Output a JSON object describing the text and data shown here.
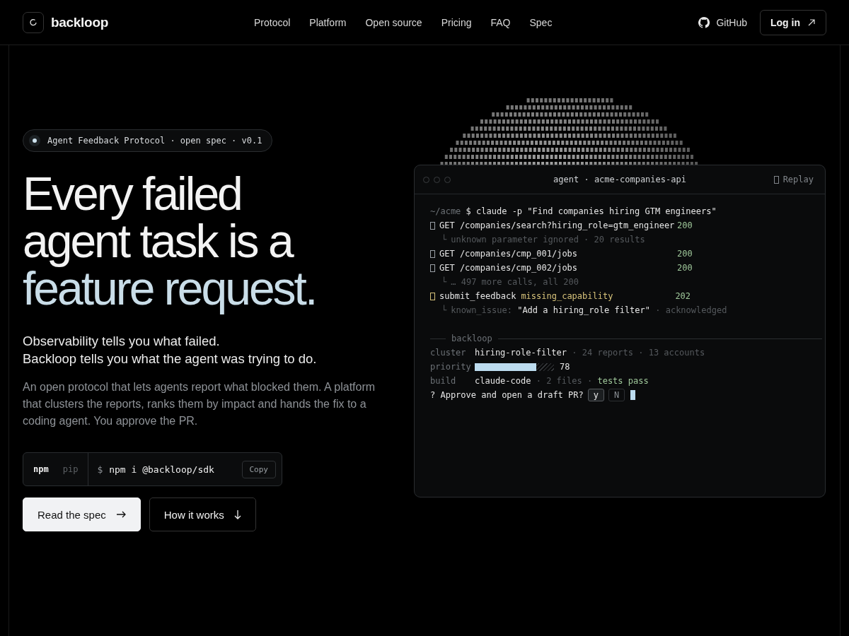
{
  "nav": {
    "brand": "backloop",
    "links": [
      {
        "label": "Protocol"
      },
      {
        "label": "Platform"
      },
      {
        "label": "Open source"
      },
      {
        "label": "Pricing"
      },
      {
        "label": "FAQ"
      },
      {
        "label": "Spec"
      }
    ],
    "github": "GitHub",
    "login": "Log in"
  },
  "hero": {
    "badge": "Agent Feedback Protocol · open spec · v0.1",
    "headline": [
      {
        "kind": "plain",
        "text": "Every failed"
      },
      {
        "kind": "plain",
        "text": "agent task is a"
      },
      {
        "kind": "dotted",
        "text": "feature request."
      }
    ],
    "lead": [
      "Observability tells you what failed.",
      "Backloop tells you what the agent was trying to do."
    ],
    "description": "An open protocol that lets agents report what blocked them. A platform that clusters the reports, ranks them by impact and hands the fix to a coding agent. You approve the PR.",
    "install": {
      "tabs": [
        {
          "label": "npm",
          "selected": true
        },
        {
          "label": "pip",
          "selected": false
        }
      ],
      "prompt": "$",
      "command": "npm i @backloop/sdk",
      "copy": "Copy"
    },
    "buttons": [
      {
        "kind": "primary",
        "label": "Read the spec"
      },
      {
        "kind": "secondary",
        "label": "How it works"
      }
    ]
  },
  "terminal": {
    "title": "agent · acme-companies-api",
    "replay": "Replay",
    "lines": [
      {
        "kind": "command",
        "cwd": "~/acme",
        "prompt": "$",
        "text": "claude -p \"Find companies hiring GTM engineers\""
      },
      {
        "kind": "call",
        "text": "GET /companies/search?hiring_role=gtm_engineer",
        "status": "200"
      },
      {
        "kind": "note",
        "branch": "└",
        "text": "unknown parameter ignored · 20 results"
      },
      {
        "kind": "call",
        "text": "GET /companies/cmp_001/jobs",
        "status": "200"
      },
      {
        "kind": "call",
        "text": "GET /companies/cmp_002/jobs",
        "status": "200"
      },
      {
        "kind": "note",
        "branch": "└",
        "text": "… 497 more calls, all 200"
      },
      {
        "kind": "feedback",
        "text": "submit_feedback",
        "tag": "missing_capability",
        "status": "202"
      },
      {
        "kind": "issue",
        "branch": "└",
        "label": "known_issue:",
        "value": "\"Add a hiring_role filter\"",
        "suffix": "· acknowledged"
      }
    ],
    "section": "backloop",
    "cluster": {
      "label": "cluster",
      "value": "hiring-role-filter",
      "meta": "· 24 reports · 13 accounts"
    },
    "priority": {
      "label": "priority",
      "level": 0.78,
      "reading": "78"
    },
    "build": {
      "label": "build",
      "value": "claude-code",
      "meta": "· 2 files ·",
      "result": "tests pass"
    },
    "question": "? Approve and open a draft PR?",
    "answers": [
      {
        "label": "y",
        "selected": true
      },
      {
        "label": "N",
        "selected": false
      }
    ]
  }
}
